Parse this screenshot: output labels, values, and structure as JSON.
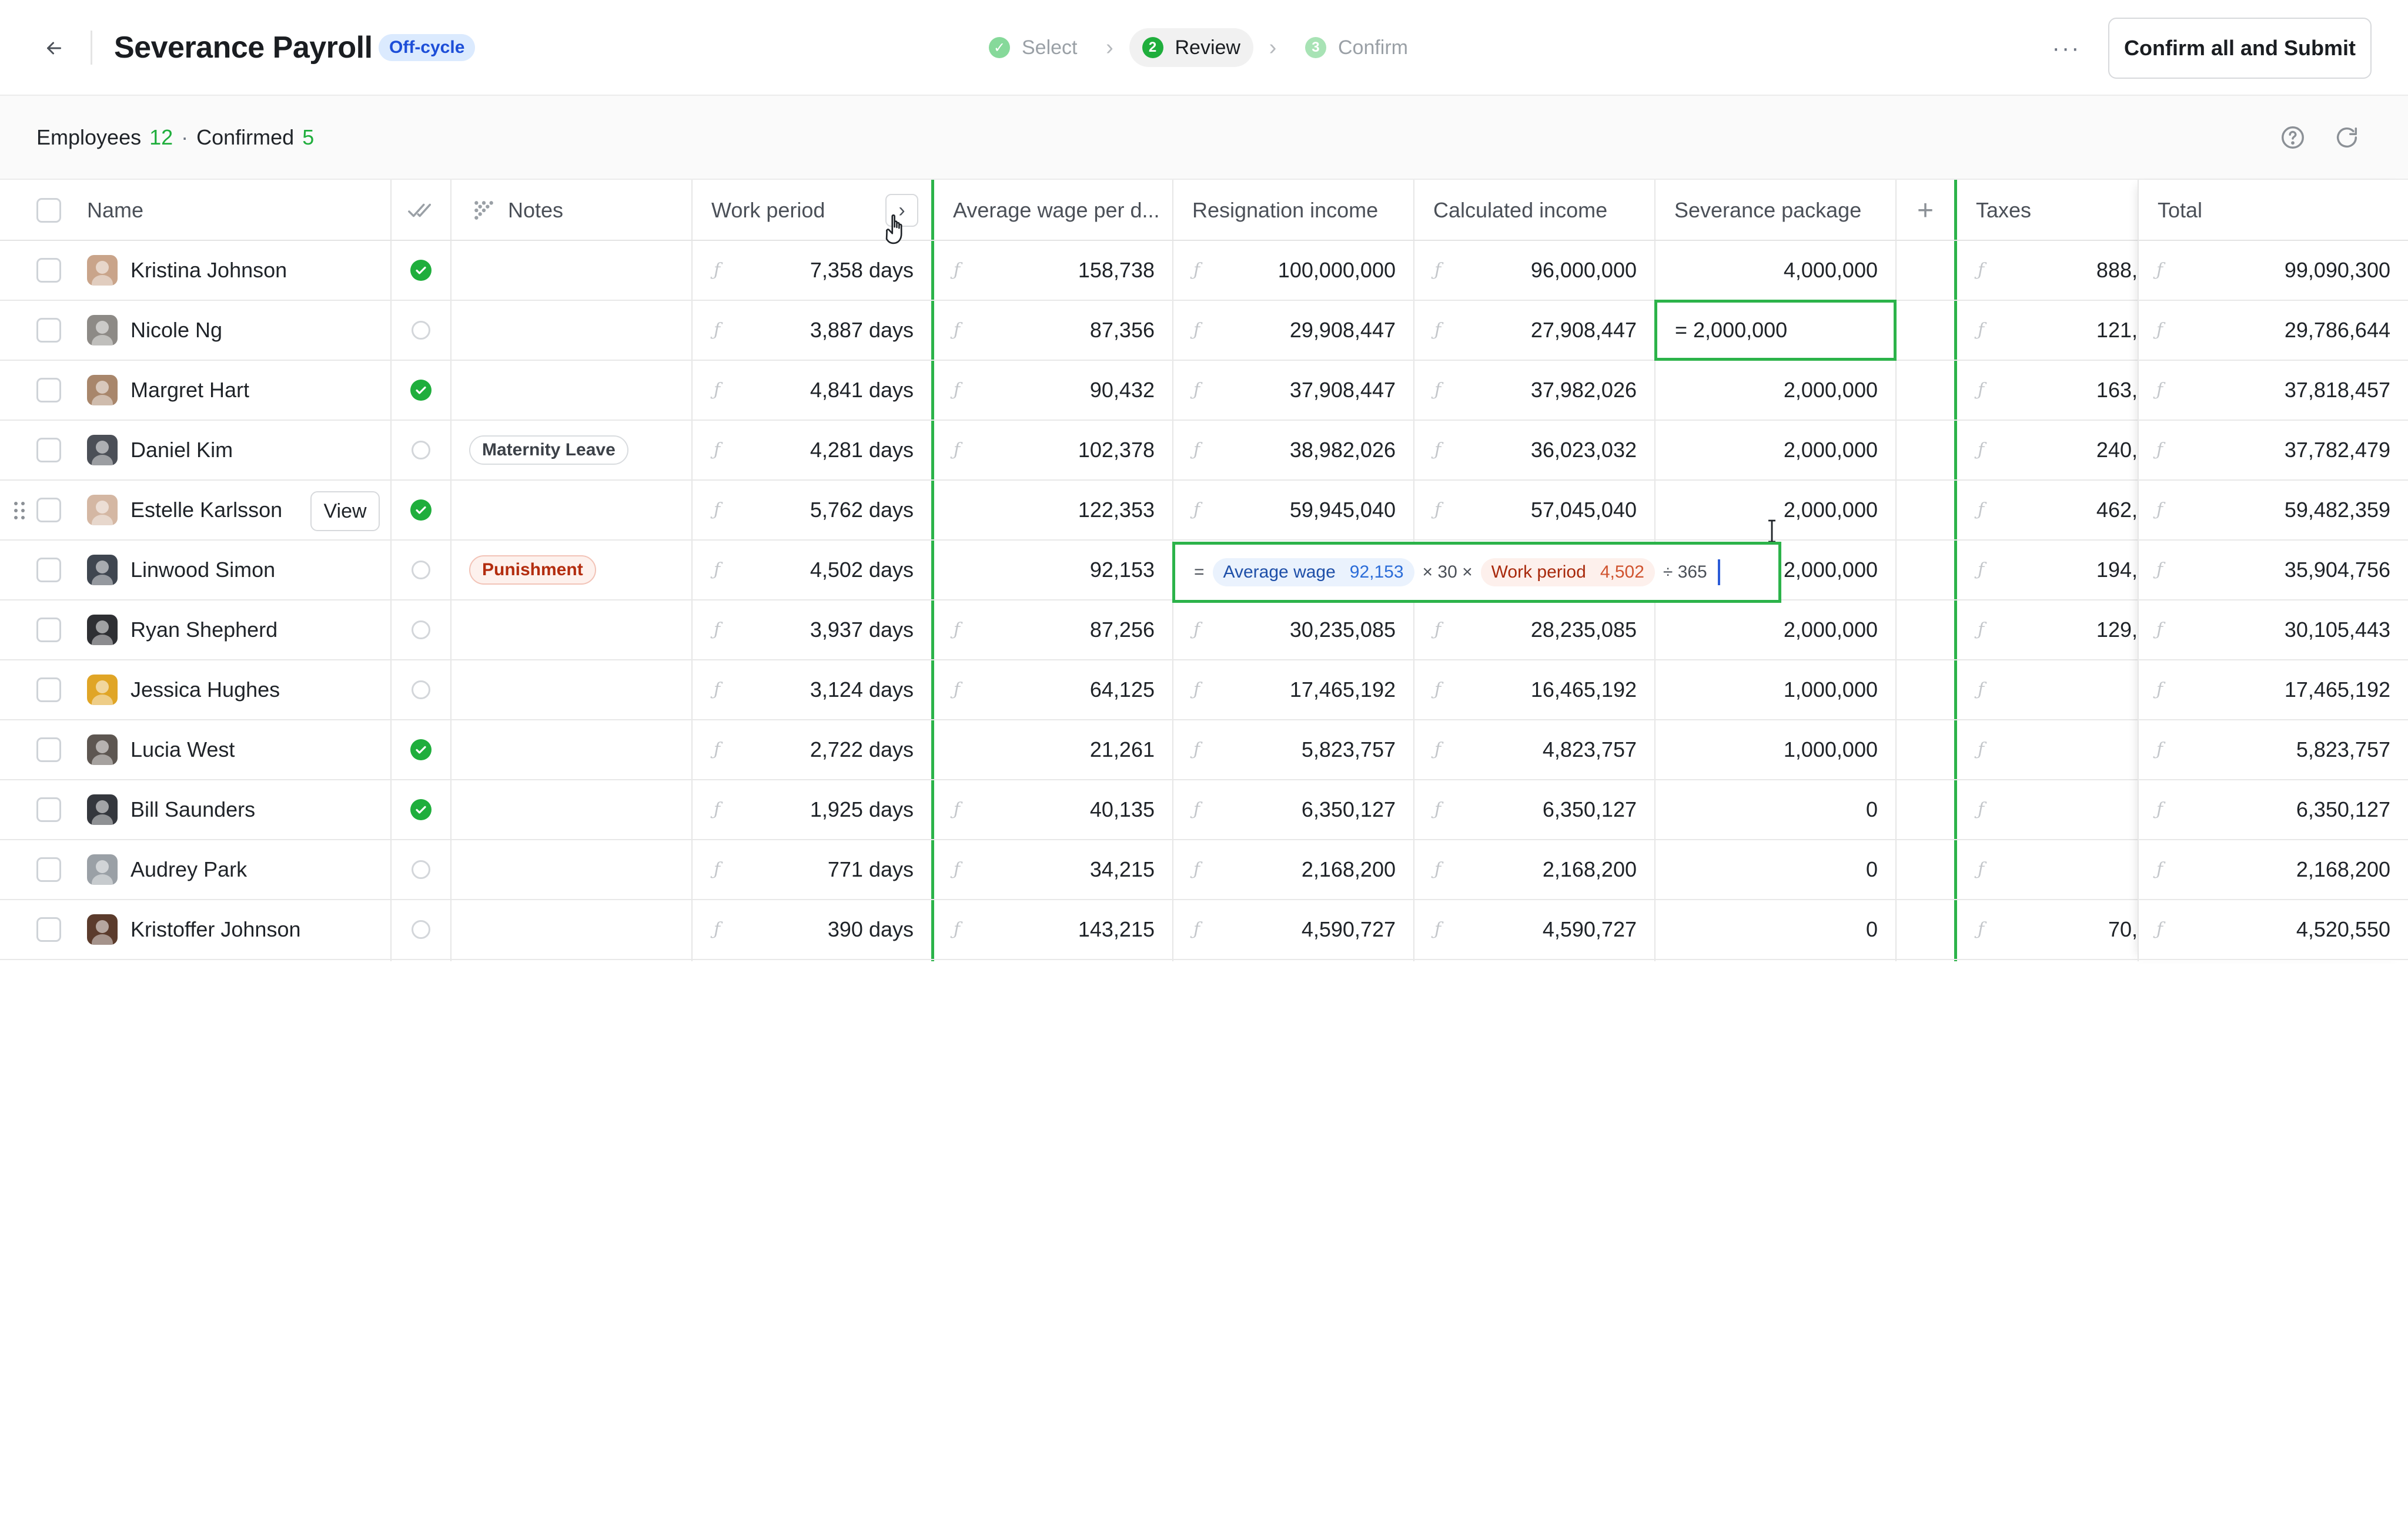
{
  "header": {
    "title": "Severance Payroll",
    "tag": "Off-cycle",
    "submit_label": "Confirm all and Submit",
    "more_label": "···",
    "steps": [
      {
        "number": "✓",
        "label": "Select",
        "state": "done"
      },
      {
        "number": "2",
        "label": "Review",
        "state": "active"
      },
      {
        "number": "3",
        "label": "Confirm",
        "state": "todo"
      }
    ]
  },
  "summary": {
    "employees_label": "Employees",
    "employees_count": "12",
    "separator": "·",
    "confirmed_label": "Confirmed",
    "confirmed_count": "5"
  },
  "columns": {
    "name": "Name",
    "notes": "Notes",
    "work_period": "Work period",
    "avg_wage": "Average wage per d...",
    "resignation_income": "Resignation income",
    "calculated_income": "Calculated income",
    "severance_package": "Severance package",
    "add_column": "+",
    "taxes": "Taxes",
    "total": "Total"
  },
  "colors": {
    "accent_green": "#2cb34a",
    "confirmed_green": "#1fae3c",
    "tag_blue": "#dbeafe",
    "punishment_red": "#b32d0f"
  },
  "rows": [
    {
      "name": "Kristina Johnson",
      "confirmed": true,
      "note": "",
      "note_type": "",
      "work_period": "7,358 days",
      "avg_wage": "158,738",
      "resignation_income": "100,000,000",
      "calculated_income": "96,000,000",
      "severance": "4,000,000",
      "taxes": "888,",
      "total": "99,090,300",
      "avatar_color": "#c9a48a"
    },
    {
      "name": "Nicole Ng",
      "confirmed": false,
      "note": "",
      "note_type": "",
      "work_period": "3,887 days",
      "avg_wage": "87,356",
      "resignation_income": "29,908,447",
      "calculated_income": "27,908,447",
      "severance": "= 2,000,000",
      "taxes": "121,",
      "total": "29,786,644",
      "avatar_color": "#8d8a86"
    },
    {
      "name": "Margret Hart",
      "confirmed": true,
      "note": "",
      "note_type": "",
      "work_period": "4,841 days",
      "avg_wage": "90,432",
      "resignation_income": "37,908,447",
      "calculated_income": "37,982,026",
      "severance": "2,000,000",
      "taxes": "163,",
      "total": "37,818,457",
      "avatar_color": "#a8866b"
    },
    {
      "name": "Daniel Kim",
      "confirmed": false,
      "note": "Maternity Leave",
      "note_type": "neutral",
      "work_period": "4,281 days",
      "avg_wage": "102,378",
      "resignation_income": "38,982,026",
      "calculated_income": "36,023,032",
      "severance": "2,000,000",
      "taxes": "240,",
      "total": "37,782,479",
      "avatar_color": "#4b4f57"
    },
    {
      "name": "Estelle Karlsson",
      "confirmed": true,
      "note": "",
      "note_type": "",
      "work_period": "5,762 days",
      "avg_wage": "122,353",
      "resignation_income": "59,945,040",
      "calculated_income": "57,045,040",
      "severance": "2,000,000",
      "taxes": "462,",
      "total": "59,482,359",
      "avatar_color": "#d4b7a3",
      "view_label": "View"
    },
    {
      "name": "Linwood Simon",
      "confirmed": false,
      "note": "Punishment",
      "note_type": "red",
      "work_period": "4,502 days",
      "avg_wage": "92,153",
      "resignation_income": "",
      "calculated_income": "",
      "severance": "2,000,000",
      "taxes": "194,",
      "total": "35,904,756",
      "avatar_color": "#3f4650"
    },
    {
      "name": "Ryan Shepherd",
      "confirmed": false,
      "note": "",
      "note_type": "",
      "work_period": "3,937 days",
      "avg_wage": "87,256",
      "resignation_income": "30,235,085",
      "calculated_income": "28,235,085",
      "severance": "2,000,000",
      "taxes": "129,",
      "total": "30,105,443",
      "avatar_color": "#2e2f33"
    },
    {
      "name": "Jessica Hughes",
      "confirmed": false,
      "note": "",
      "note_type": "",
      "work_period": "3,124 days",
      "avg_wage": "64,125",
      "resignation_income": "17,465,192",
      "calculated_income": "16,465,192",
      "severance": "1,000,000",
      "taxes": "",
      "total": "17,465,192",
      "avatar_color": "#e0a526"
    },
    {
      "name": "Lucia West",
      "confirmed": true,
      "note": "",
      "note_type": "",
      "work_period": "2,722 days",
      "avg_wage": "21,261",
      "resignation_income": "5,823,757",
      "calculated_income": "4,823,757",
      "severance": "1,000,000",
      "taxes": "",
      "total": "5,823,757",
      "avatar_color": "#5d5651"
    },
    {
      "name": "Bill Saunders",
      "confirmed": true,
      "note": "",
      "note_type": "",
      "work_period": "1,925 days",
      "avg_wage": "40,135",
      "resignation_income": "6,350,127",
      "calculated_income": "6,350,127",
      "severance": "0",
      "taxes": "",
      "total": "6,350,127",
      "avatar_color": "#34373d"
    },
    {
      "name": "Audrey Park",
      "confirmed": false,
      "note": "",
      "note_type": "",
      "work_period": "771 days",
      "avg_wage": "34,215",
      "resignation_income": "2,168,200",
      "calculated_income": "2,168,200",
      "severance": "0",
      "taxes": "",
      "total": "2,168,200",
      "avatar_color": "#9aa0a6"
    },
    {
      "name": "Kristoffer Johnson",
      "confirmed": false,
      "note": "",
      "note_type": "",
      "work_period": "390 days",
      "avg_wage": "143,215",
      "resignation_income": "4,590,727",
      "calculated_income": "4,590,727",
      "severance": "0",
      "taxes": "70,",
      "total": "4,520,550",
      "avatar_color": "#5b3b2c"
    }
  ],
  "formula": {
    "equals": "=",
    "avg_wage_label": "Average wage",
    "avg_wage_value": "92,153",
    "op1": "× 30 ×",
    "work_period_label": "Work period",
    "work_period_value": "4,502",
    "op2": "÷ 365"
  },
  "icons": {
    "back": "arrow-left-icon",
    "help": "help-circle-icon",
    "refresh": "refresh-icon",
    "confirm_col": "double-check-icon",
    "notes_col": "sparkle-grid-icon",
    "sort": "chevron-right-icon"
  }
}
